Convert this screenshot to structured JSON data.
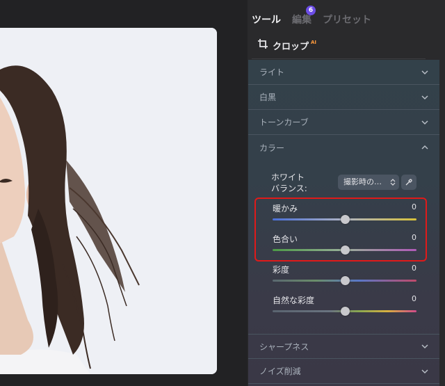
{
  "tabs": [
    {
      "label": "ツール",
      "active": true
    },
    {
      "label": "編集",
      "active": false,
      "badge": "6"
    },
    {
      "label": "プリセット",
      "active": false
    }
  ],
  "crop": {
    "label": "クロップ",
    "ai_tag": "AI"
  },
  "sections": [
    {
      "label": "ライト",
      "expanded": false
    },
    {
      "label": "白黒",
      "expanded": false
    },
    {
      "label": "トーンカーブ",
      "expanded": false
    },
    {
      "label": "カラー",
      "expanded": true
    },
    {
      "label": "シャープネス",
      "expanded": false
    },
    {
      "label": "ノイズ削減",
      "expanded": false
    }
  ],
  "white_balance": {
    "label_line1": "ホワイト",
    "label_line2": "バランス:",
    "value": "撮影時の…"
  },
  "sliders": [
    {
      "label": "暖かみ",
      "value": "0",
      "level": 0.5
    },
    {
      "label": "色合い",
      "value": "0",
      "level": 0.5
    },
    {
      "label": "彩度",
      "value": "0",
      "level": 0.5
    },
    {
      "label": "自然な彩度",
      "value": "0",
      "level": 0.5
    }
  ],
  "colors": {
    "accent_badge": "#6c4de6",
    "ai_tag": "#ff9a3c",
    "highlight": "#e01a1a"
  }
}
